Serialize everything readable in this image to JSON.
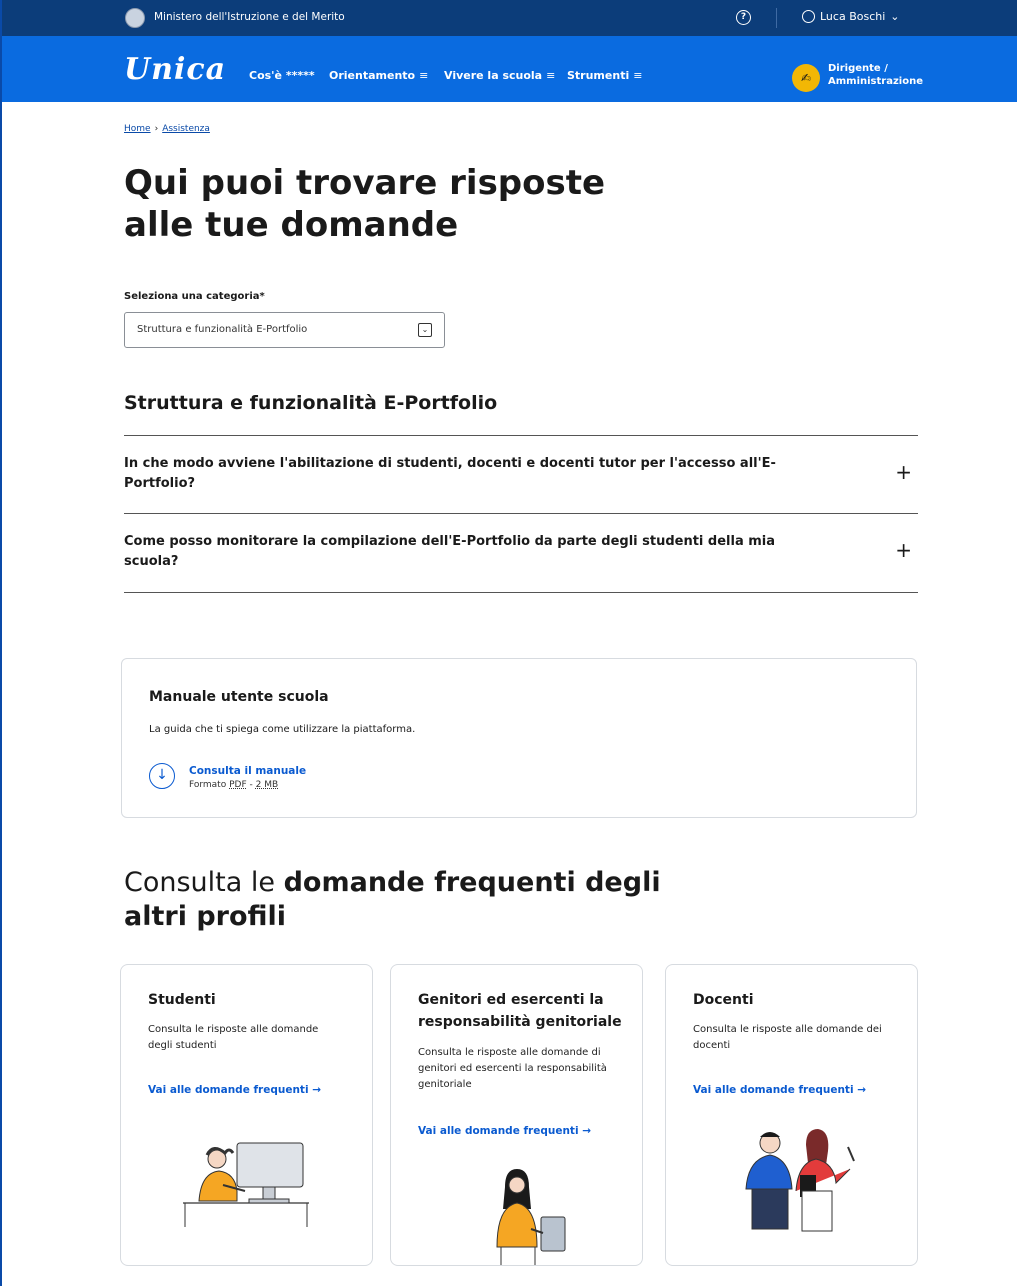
{
  "topbar": {
    "ministry": "Ministero dell'Istruzione e del Merito",
    "help_icon": "help-circle-icon",
    "user": "Luca Boschi",
    "user_chevron": "⌄"
  },
  "nav": {
    "logo": "Unica",
    "items": [
      {
        "label": "Cos'è *****",
        "menu": ""
      },
      {
        "label": "Orientamento",
        "menu": "≡"
      },
      {
        "label": "Vivere la scuola",
        "menu": "≡"
      },
      {
        "label": "Strumenti",
        "menu": "≡"
      }
    ],
    "role_line1": "Dirigente /",
    "role_line2": "Amministrazione"
  },
  "breadcrumb": {
    "home": "Home",
    "sep": "›",
    "current": "Assistenza"
  },
  "page_title": "Qui puoi trovare risposte alle tue domande",
  "category": {
    "label": "Seleziona una categoria*",
    "selected": "Struttura e funzionalità E-Portfolio"
  },
  "section_title": "Struttura e funzionalità E-Portfolio",
  "faqs": [
    {
      "question": "In che modo avviene l'abilitazione di studenti, docenti e docenti tutor per l'accesso all'E-Portfolio?"
    },
    {
      "question": "Come posso monitorare la compilazione dell'E-Portfolio da parte degli studenti della mia scuola?"
    }
  ],
  "manual": {
    "title": "Manuale utente scuola",
    "description": "La guida che ti spiega come utilizzare la piattaforma.",
    "link": "Consulta il manuale",
    "format_prefix": "Formato",
    "format": "PDF",
    "size": "2 MB"
  },
  "others": {
    "title_prefix": "Consulta le",
    "title_bold": "domande frequenti degli altri profili"
  },
  "profiles": [
    {
      "title": "Studenti",
      "description": "Consulta le risposte alle domande degli studenti",
      "link": "Vai alle domande frequenti →"
    },
    {
      "title": "Genitori ed esercenti la responsabilità genitoriale",
      "description": "Consulta le risposte alle domande di genitori ed esercenti la responsabilità genitoriale",
      "link": "Vai alle domande frequenti →"
    },
    {
      "title": "Docenti",
      "description": "Consulta le risposte alle domande dei docenti",
      "link": "Vai alle domande frequenti →"
    }
  ],
  "colors": {
    "topbar": "#0c3d7a",
    "navbar": "#0a6be0",
    "link": "#0a5ad0",
    "accent": "#f2b705"
  }
}
